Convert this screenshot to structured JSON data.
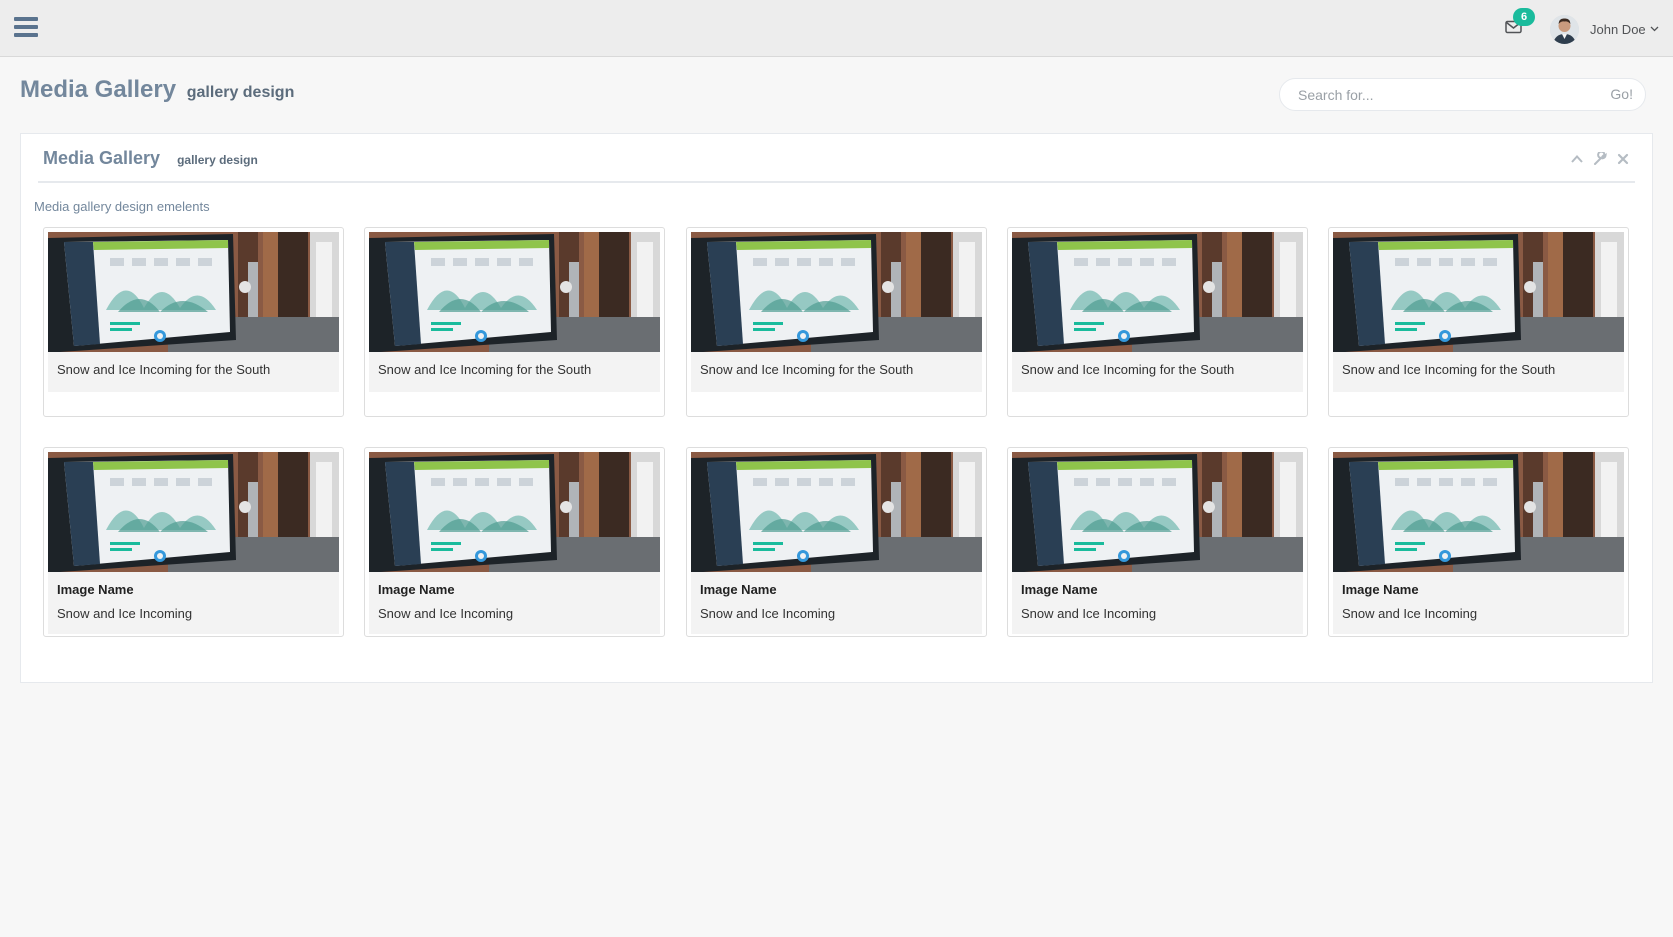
{
  "header": {
    "menu_icon": "hamburger-menu-icon",
    "mail_icon": "envelope-icon",
    "notification_count": "6",
    "user_name": "John Doe",
    "user_caret_icon": "chevron-down-icon"
  },
  "page": {
    "title": "Media Gallery",
    "subtitle": "gallery design",
    "search_placeholder": "Search for...",
    "search_button": "Go!"
  },
  "panel": {
    "title": "Media Gallery",
    "subtitle": "gallery design",
    "tools": [
      "chevron-up-icon",
      "wrench-icon",
      "close-icon"
    ],
    "description": "Media gallery design emelents"
  },
  "gallery": {
    "row1": [
      {
        "caption": "Snow and Ice Incoming for the South"
      },
      {
        "caption": "Snow and Ice Incoming for the South"
      },
      {
        "caption": "Snow and Ice Incoming for the South"
      },
      {
        "caption": "Snow and Ice Incoming for the South"
      },
      {
        "caption": "Snow and Ice Incoming for the South"
      }
    ],
    "row2": [
      {
        "name": "Image Name",
        "caption": "Snow and Ice Incoming"
      },
      {
        "name": "Image Name",
        "caption": "Snow and Ice Incoming"
      },
      {
        "name": "Image Name",
        "caption": "Snow and Ice Incoming"
      },
      {
        "name": "Image Name",
        "caption": "Snow and Ice Incoming"
      },
      {
        "name": "Image Name",
        "caption": "Snow and Ice Incoming"
      }
    ]
  },
  "colors": {
    "accent": "#1abb9c",
    "heading": "#73879c",
    "menu": "#5a738e"
  }
}
